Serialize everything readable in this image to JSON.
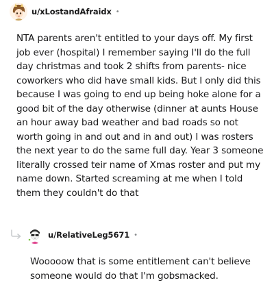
{
  "comments": [
    {
      "username": "u/xLostandAfraidx",
      "separator": "•",
      "avatar": "avatar-icon-anime-character",
      "body": "NTA parents aren't entitled to your days off. My first job ever (hospital) I remember saying I'll do the full day christmas and took 2 shifts from parents- nice coworkers who did have small kids. But I only did this because I was going to end up being hoke alone for a good bit of the day otherwise (dinner at aunts House an hour away bad weather and bad roads so not worth going in and out and in and out) I was rosters the next year to do the same full day. Year 3 someone literally crossed teir name of Xmas roster and put my name down. Started screaming at me when I told them they couldn't do that"
    },
    {
      "username": "u/RelativeLeg5671",
      "separator": "•",
      "avatar": "avatar-icon-sunglasses-character",
      "reply_icon": "reply-arrow-icon",
      "body": "Wooooow that is some entitlement can't believe someone would do that I'm gobsmacked."
    }
  ]
}
